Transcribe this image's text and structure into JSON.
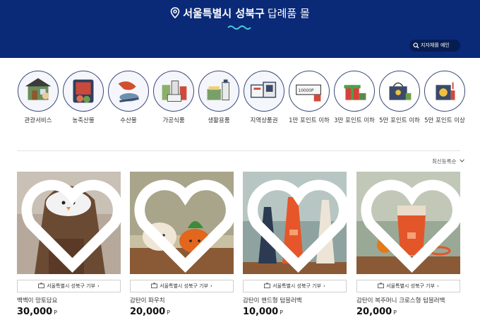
{
  "header": {
    "title_bold": "서울특별시 성북구",
    "title_regular": "답례품 몰",
    "search_button": "지자체를 예인",
    "icons": [
      "location-pin-icon",
      "wave-icon",
      "search-icon"
    ],
    "background_color": "#0a2a78"
  },
  "categories": [
    {
      "label": "관광서비스",
      "icon": "tour-service-icon"
    },
    {
      "label": "농축산물",
      "icon": "agricultural-icon"
    },
    {
      "label": "수산물",
      "icon": "seafood-icon"
    },
    {
      "label": "가공식품",
      "icon": "processed-food-icon"
    },
    {
      "label": "생활용품",
      "icon": "household-goods-icon"
    },
    {
      "label": "지역상품권",
      "icon": "gift-certificate-icon"
    },
    {
      "label": "1만 포인트 이하",
      "icon": "voucher-icon"
    },
    {
      "label": "3만 포인트 이하",
      "icon": "gift-box-icon"
    },
    {
      "label": "5만 포인트 이하",
      "icon": "gift-bag-icon"
    },
    {
      "label": "5만 포인트 이상",
      "icon": "gift-premium-icon"
    }
  ],
  "sort": {
    "label": "최신등록순"
  },
  "products": [
    {
      "donate_label": "서울특별시 성북구 기부",
      "name": "백백이 망토담요",
      "price": "30,000",
      "currency": "P"
    },
    {
      "donate_label": "서울특별시 성북구 기부",
      "name": "감탄이 파우치",
      "price": "20,000",
      "currency": "P"
    },
    {
      "donate_label": "서울특별시 성북구 기부",
      "name": "감탄이 핸드형 텀블러백",
      "price": "10,000",
      "currency": "P"
    },
    {
      "donate_label": "서울특별시 성북구 기부",
      "name": "감탄이 복주머니 크로스형 텀블러백",
      "price": "20,000",
      "currency": "P"
    }
  ]
}
